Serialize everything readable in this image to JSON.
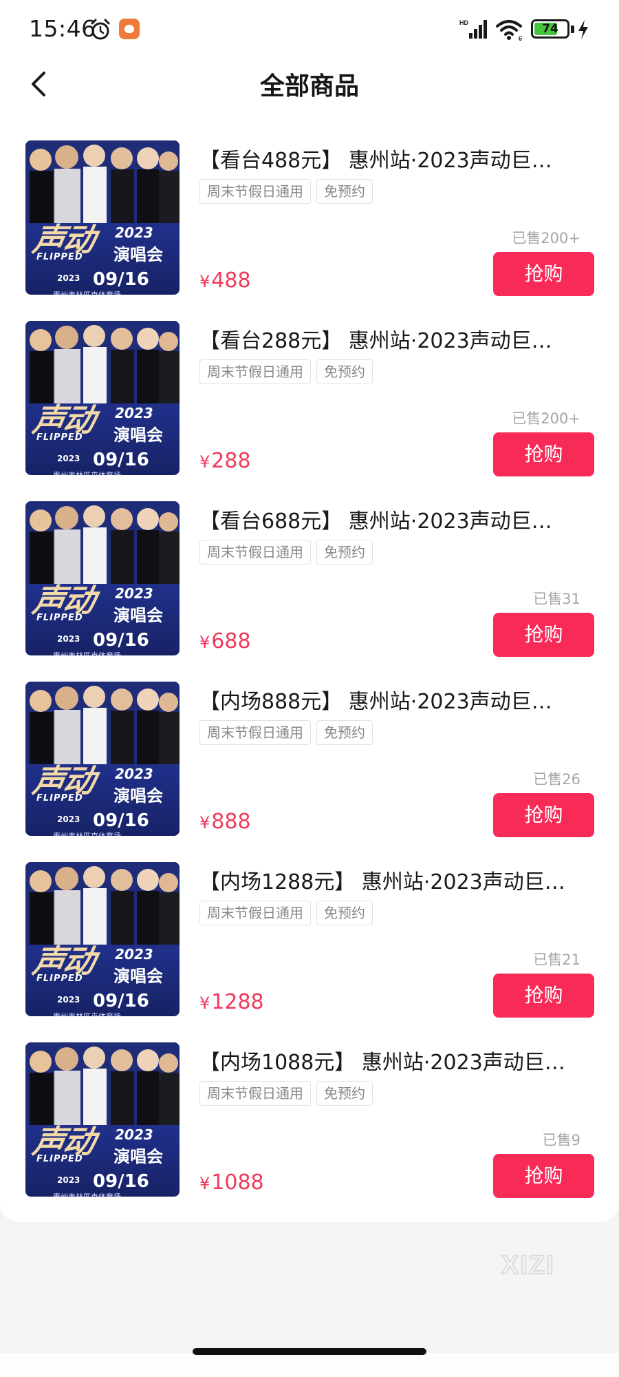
{
  "status_bar": {
    "time": "15:46",
    "battery_level": "74"
  },
  "nav": {
    "title": "全部商品"
  },
  "thumbnail": {
    "logo_cn": "声动",
    "logo_en": "FLIPPED",
    "logo_year": "2023",
    "logo_show": "演唱会",
    "date_year": "2023",
    "date_md": "09/16",
    "venue": "惠州奥林匹克体育场"
  },
  "currency_symbol": "¥",
  "buy_label": "抢购",
  "products": [
    {
      "title": "【看台488元】 惠州站·2023声动巨…",
      "tags": [
        "周末节假日通用",
        "免预约"
      ],
      "sold": "已售200+",
      "price": "488"
    },
    {
      "title": "【看台288元】 惠州站·2023声动巨…",
      "tags": [
        "周末节假日通用",
        "免预约"
      ],
      "sold": "已售200+",
      "price": "288"
    },
    {
      "title": "【看台688元】 惠州站·2023声动巨…",
      "tags": [
        "周末节假日通用",
        "免预约"
      ],
      "sold": "已售31",
      "price": "688"
    },
    {
      "title": "【内场888元】 惠州站·2023声动巨…",
      "tags": [
        "周末节假日通用",
        "免预约"
      ],
      "sold": "已售26",
      "price": "888"
    },
    {
      "title": "【内场1288元】 惠州站·2023声动巨…",
      "tags": [
        "周末节假日通用",
        "免预约"
      ],
      "sold": "已售21",
      "price": "1288"
    },
    {
      "title": "【内场1088元】 惠州站·2023声动巨…",
      "tags": [
        "周末节假日通用",
        "免预约"
      ],
      "sold": "已售9",
      "price": "1088"
    }
  ],
  "watermark": "XIZI"
}
